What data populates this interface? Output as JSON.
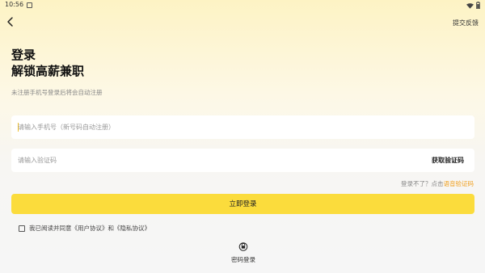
{
  "status_bar": {
    "time": "10:56"
  },
  "header": {
    "feedback_label": "提交反馈"
  },
  "titles": {
    "line1": "登录",
    "line2": "解锁高薪兼职"
  },
  "subtitle": "未注册手机号登录后将会自动注册",
  "phone_field": {
    "placeholder": "请输入手机号（新号码自动注册）",
    "value": ""
  },
  "code_field": {
    "placeholder": "请输入验证码",
    "value": "",
    "get_code_label": "获取验证码"
  },
  "voice_code": {
    "prompt": "登录不了？点击",
    "link": "语音验证码"
  },
  "login_button": {
    "label": "立即登录"
  },
  "agreement": {
    "text": "我已阅读并同意《用户协议》和《隐私协议》",
    "checked": false
  },
  "password_login": {
    "label": "密码登录",
    "icon": "lock-icon"
  },
  "colors": {
    "accent": "#fbdc3c",
    "link": "#f0a020"
  }
}
